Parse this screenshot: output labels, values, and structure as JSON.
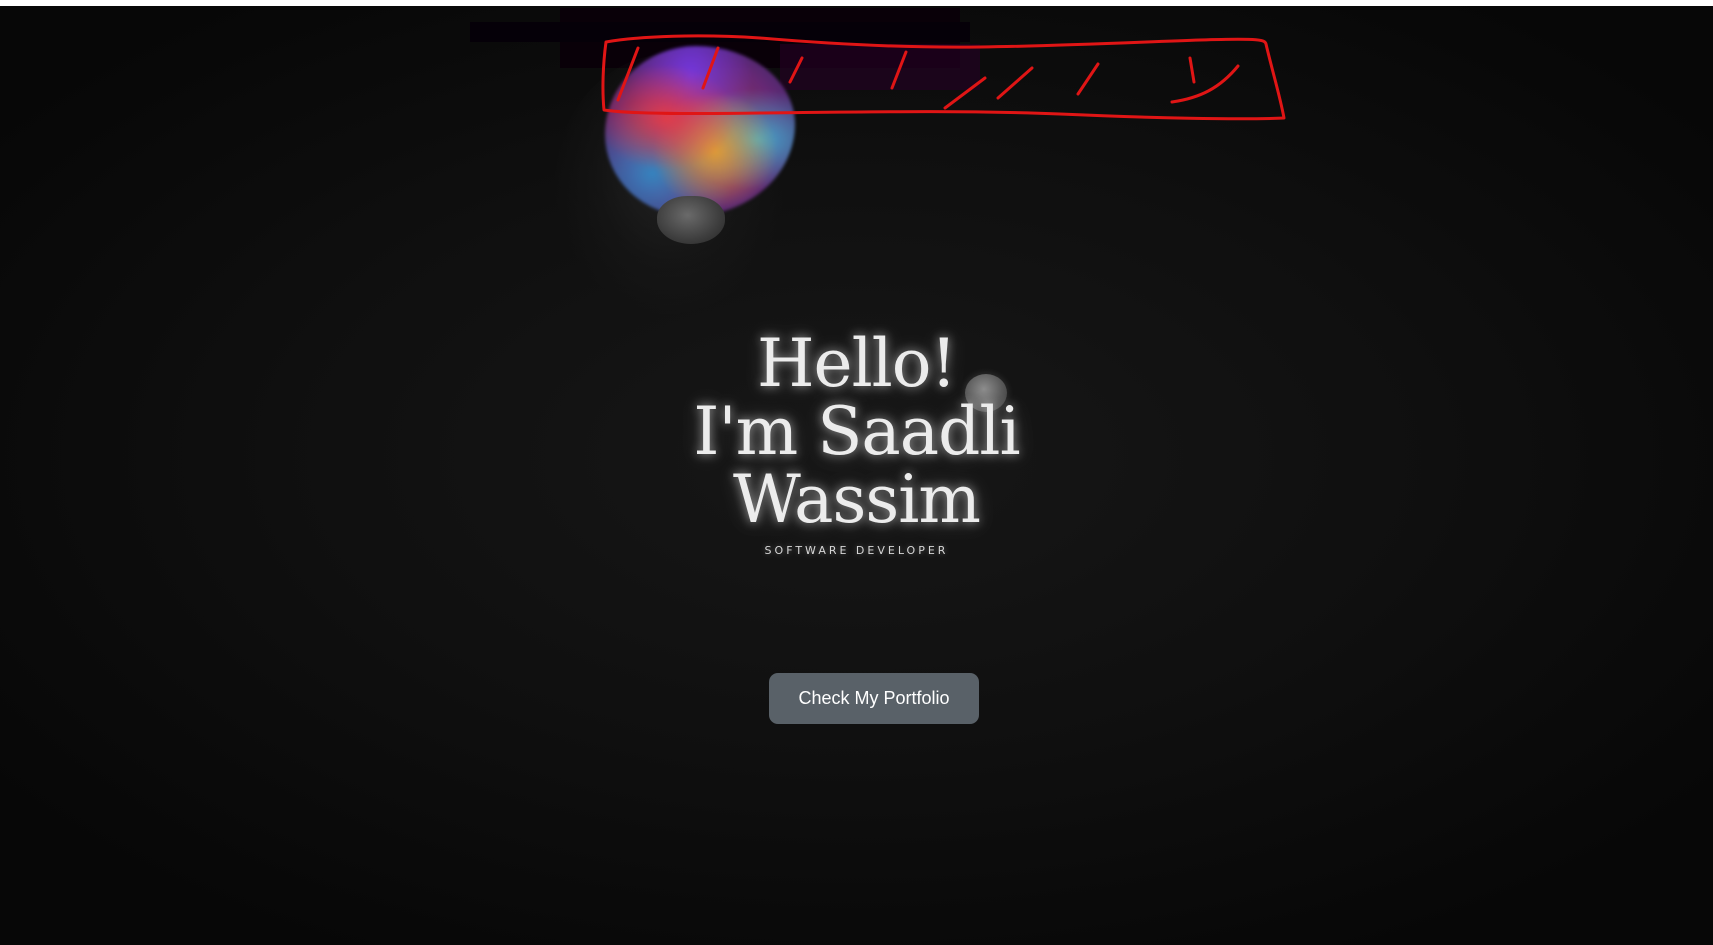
{
  "hero": {
    "greeting": "Hello!",
    "name_line_1": "I'm Saadli",
    "name_line_2": "Wassim",
    "subtitle": "SOFTWARE DEVELOPER"
  },
  "cta": {
    "label": "Check My Portfolio"
  },
  "colors": {
    "background": "#0f0f0f",
    "button": "#596168",
    "annotation": "#e01515",
    "text": "#ececec"
  }
}
